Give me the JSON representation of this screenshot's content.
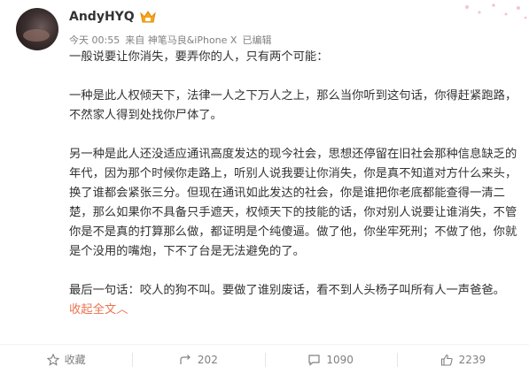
{
  "user": {
    "name": "AndyHYQ"
  },
  "meta": {
    "time": "今天 00:55",
    "source": "来自 神笔马良&iPhone X",
    "edited": "已编辑"
  },
  "post": {
    "p1": "一般说要让你消失，要弄你的人，只有两个可能：",
    "p2": "一种是此人权倾天下，法律一人之下万人之上，那么当你听到这句话，你得赶紧跑路，不然家人得到处找你尸体了。",
    "p3": "另一种是此人还没适应通讯高度发达的现今社会，思想还停留在旧社会那种信息缺乏的年代，因为那个时候你走路上，听别人说我要让你消失，你是真不知道对方什么来头，换了谁都会紧张三分。但现在通讯如此发达的社会，你是谁把你老底都能查得一清二楚，那么如果你不具备只手遮天，权倾天下的技能的话，你对别人说要让谁消失，不管你是不是真的打算那么做，都证明是个纯傻逼。做了他，你坐牢死刑；不做了他，你就是个没用的嘴炮，下不了台是无法避免的了。",
    "p4": "最后一句话：咬人的狗不叫。要做了谁别废话，看不到人头杨子叫所有人一声爸爸。",
    "collapse_label": "收起全文",
    "collapse_arrow": "︿"
  },
  "actions": {
    "favorite": "收藏",
    "repost": "202",
    "comment": "1090",
    "like": "2239"
  },
  "colors": {
    "accent": "#eb7350",
    "text": "#333333",
    "muted": "#808080"
  }
}
